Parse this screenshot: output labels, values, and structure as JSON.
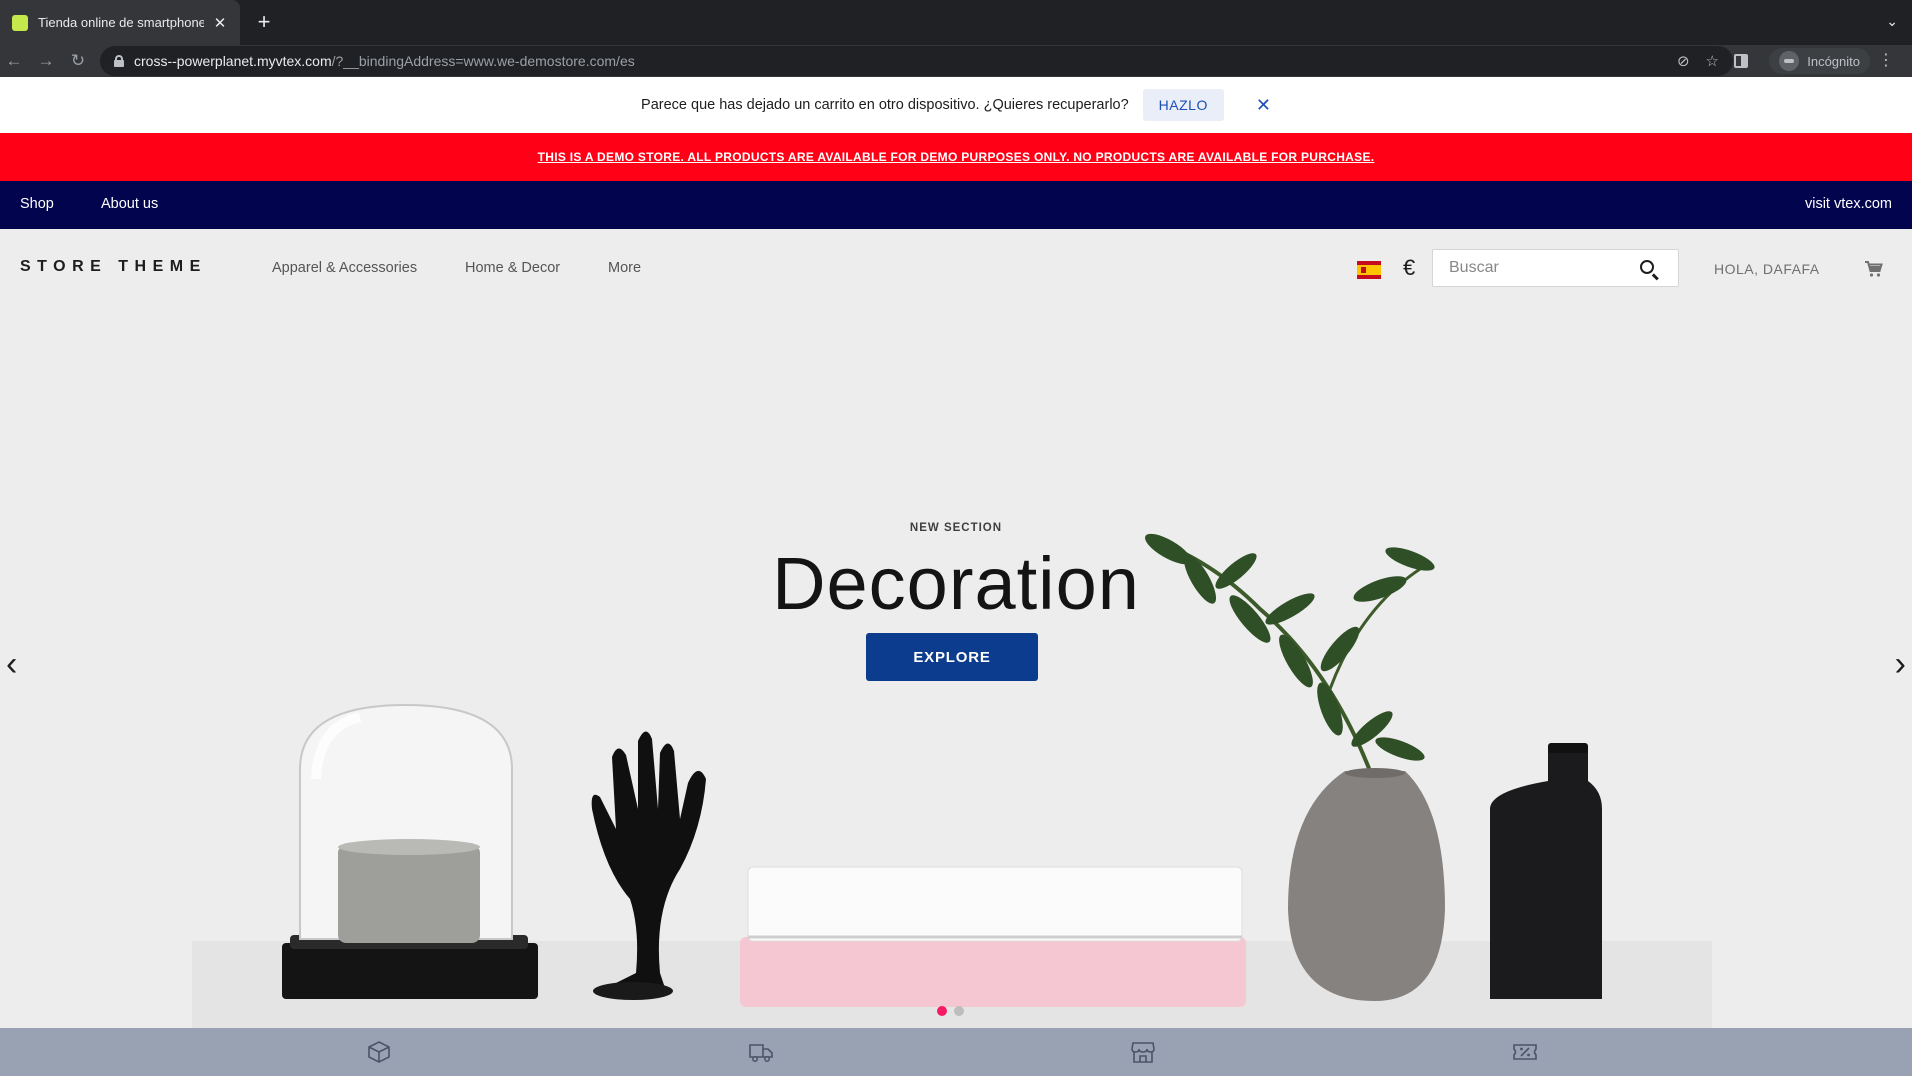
{
  "browser": {
    "tab_title": "Tienda online de smartphones,",
    "url_host": "cross--powerplanet.myvtex.com",
    "url_path": "/?__bindingAddress=www.we-demostore.com/es",
    "incognito_label": "Incógnito"
  },
  "notice": {
    "message": "Parece que has dejado un carrito en otro dispositivo. ¿Quieres recuperarlo?",
    "action_label": "HAZLO"
  },
  "demo_banner": "THIS IS A DEMO STORE. ALL PRODUCTS ARE AVAILABLE FOR DEMO PURPOSES ONLY. NO PRODUCTS ARE AVAILABLE FOR PURCHASE.",
  "top_nav": {
    "shop": "Shop",
    "about": "About us",
    "visit": "visit vtex.com"
  },
  "header": {
    "logo": "STORE THEME",
    "menu": [
      "Apparel & Accessories",
      "Home & Decor",
      "More"
    ],
    "currency": "€",
    "search_placeholder": "Buscar",
    "greeting": "HOLA, DAFAFA"
  },
  "hero": {
    "eyebrow": "NEW SECTION",
    "headline": "Decoration",
    "cta": "EXPLORE",
    "slide_count": 2,
    "active_slide": 1
  },
  "colors": {
    "demo_red": "#ff0016",
    "nav_navy": "#03044e",
    "cta_blue": "#0c3c8d",
    "active_dot": "#f71963",
    "strip": "#98a2b3"
  }
}
